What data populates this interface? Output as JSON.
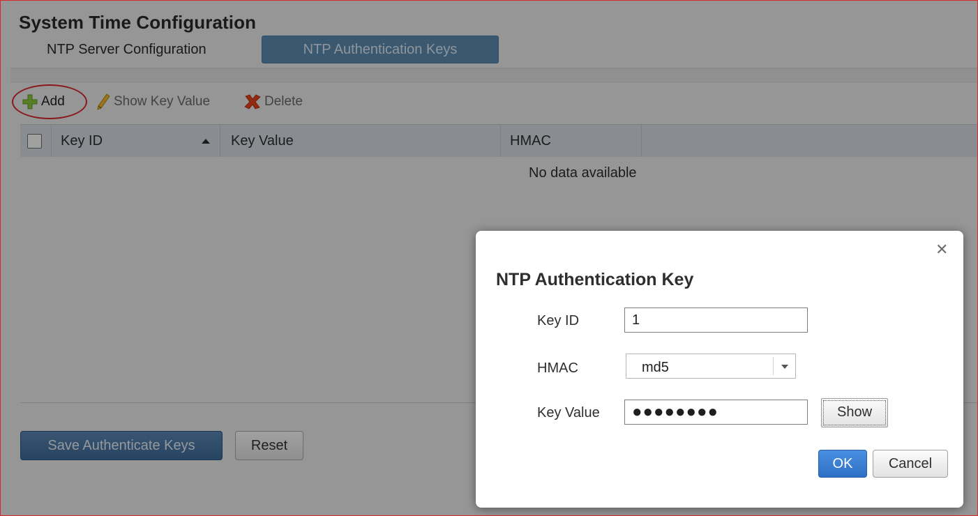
{
  "page": {
    "title": "System Time Configuration",
    "tabs": [
      {
        "label": "NTP Server Configuration",
        "active": false
      },
      {
        "label": "NTP Authentication Keys",
        "active": true
      }
    ]
  },
  "toolbar": {
    "add_label": "Add",
    "show_key_value_label": "Show Key Value",
    "delete_label": "Delete"
  },
  "grid": {
    "columns": [
      "Key ID",
      "Key Value",
      "HMAC"
    ],
    "sorted_column": "Key ID",
    "sort_direction": "ascending",
    "empty_message": "No data available"
  },
  "footer": {
    "save_label": "Save Authenticate Keys",
    "reset_label": "Reset"
  },
  "dialog": {
    "title": "NTP Authentication Key",
    "close_icon": "close-icon",
    "fields": {
      "key_id_label": "Key ID",
      "key_id_value": "1",
      "hmac_label": "HMAC",
      "hmac_value": "md5",
      "key_value_label": "Key Value",
      "key_value_masked": "●●●●●●●●"
    },
    "show_label": "Show",
    "ok_label": "OK",
    "cancel_label": "Cancel"
  },
  "colors": {
    "annotation_ring": "#d8282f",
    "active_tab": "#5b8ab0",
    "primary_button": "#3c6a98",
    "ok_button": "#2d6fc4"
  }
}
